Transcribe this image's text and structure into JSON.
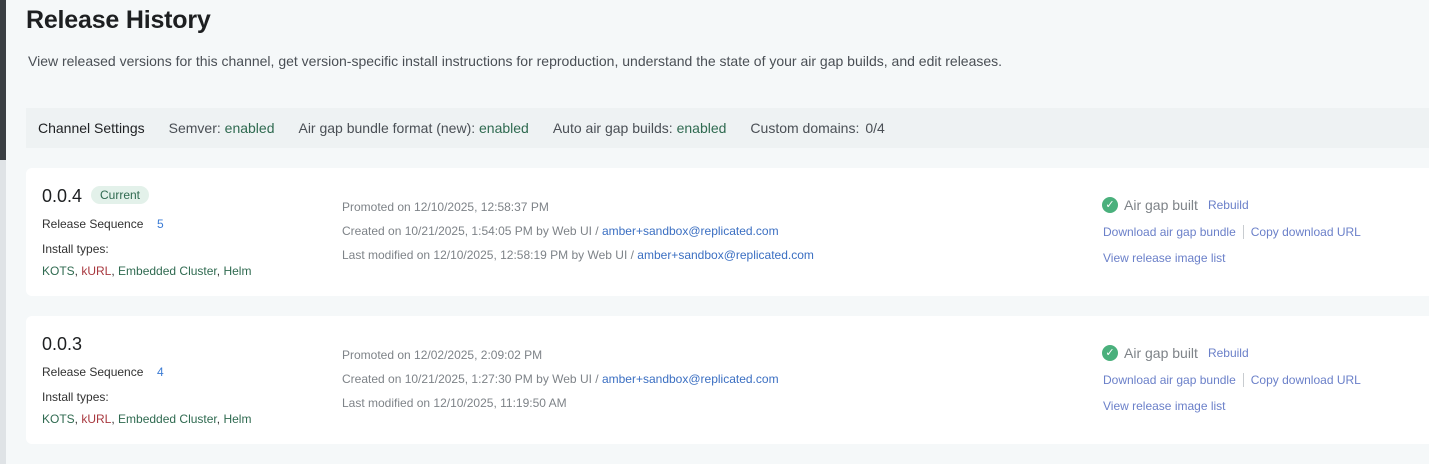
{
  "page": {
    "title": "Release History",
    "description": "View released versions for this channel, get version-specific install instructions for reproduction, understand the state of your air gap builds, and edit releases."
  },
  "channel_settings": {
    "title": "Channel Settings",
    "semver_label": "Semver:",
    "semver_value": "enabled",
    "bundle_label": "Air gap bundle format (new):",
    "bundle_value": "enabled",
    "auto_label": "Auto air gap builds:",
    "auto_value": "enabled",
    "domains_label": "Custom domains:",
    "domains_value": "0/4"
  },
  "releases": [
    {
      "version": "0.0.4",
      "badge": "Current",
      "sequence_label": "Release Sequence",
      "sequence": "5",
      "install_label": "Install types:",
      "types": [
        "KOTS",
        "kURL",
        "Embedded Cluster",
        "Helm"
      ],
      "promoted": "Promoted on 12/10/2025, 12:58:37 PM",
      "created": "Created on 10/21/2025, 1:54:05 PM by Web UI / ",
      "created_by": "amber+sandbox@replicated.com",
      "modified": "Last modified on 12/10/2025, 12:58:19 PM by Web UI / ",
      "modified_by": "amber+sandbox@replicated.com",
      "airgap_status": "Air gap built",
      "rebuild": "Rebuild",
      "download": "Download air gap bundle",
      "copy_url": "Copy download URL",
      "view_images": "View release image list"
    },
    {
      "version": "0.0.3",
      "sequence_label": "Release Sequence",
      "sequence": "4",
      "install_label": "Install types:",
      "types": [
        "KOTS",
        "kURL",
        "Embedded Cluster",
        "Helm"
      ],
      "promoted": "Promoted on 12/02/2025, 2:09:02 PM",
      "created": "Created on 10/21/2025, 1:27:30 PM by Web UI / ",
      "created_by": "amber+sandbox@replicated.com",
      "modified": "Last modified on 12/10/2025, 11:19:50 AM",
      "airgap_status": "Air gap built",
      "rebuild": "Rebuild",
      "download": "Download air gap bundle",
      "copy_url": "Copy download URL",
      "view_images": "View release image list"
    }
  ],
  "icons": {
    "status": "check-circle-icon"
  },
  "colors": {
    "enabled": "#2f6a50",
    "link": "#3b6fc2",
    "check": "#4ab07c"
  }
}
